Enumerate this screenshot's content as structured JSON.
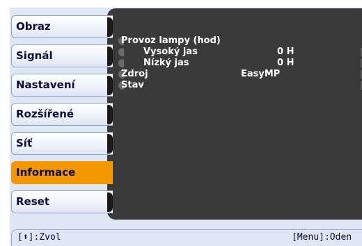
{
  "sidebar": {
    "items": [
      {
        "label": "Obraz"
      },
      {
        "label": "Signál"
      },
      {
        "label": "Nastavení"
      },
      {
        "label": "Rozšířené"
      },
      {
        "label": "Síť"
      },
      {
        "label": "Informace"
      },
      {
        "label": "Reset"
      }
    ],
    "active": "Informace"
  },
  "info": {
    "lamp_hours_label": "Provoz lampy (hod)",
    "high_brightness_label": "Vysoký jas",
    "high_brightness_value": "0 H",
    "low_brightness_label": "Nízký jas",
    "low_brightness_value": "0 H",
    "source_label": "Zdroj",
    "source_value": "EasyMP",
    "status_label": "Stav"
  },
  "footer": {
    "select_hint": "[⬍]:Zvol",
    "menu_hint": "[Menu]:Oden"
  },
  "colors": {
    "active_accent": "#f39800",
    "panel_bg": "#3a3a3a",
    "screen_bg": "#dfe7f5"
  }
}
